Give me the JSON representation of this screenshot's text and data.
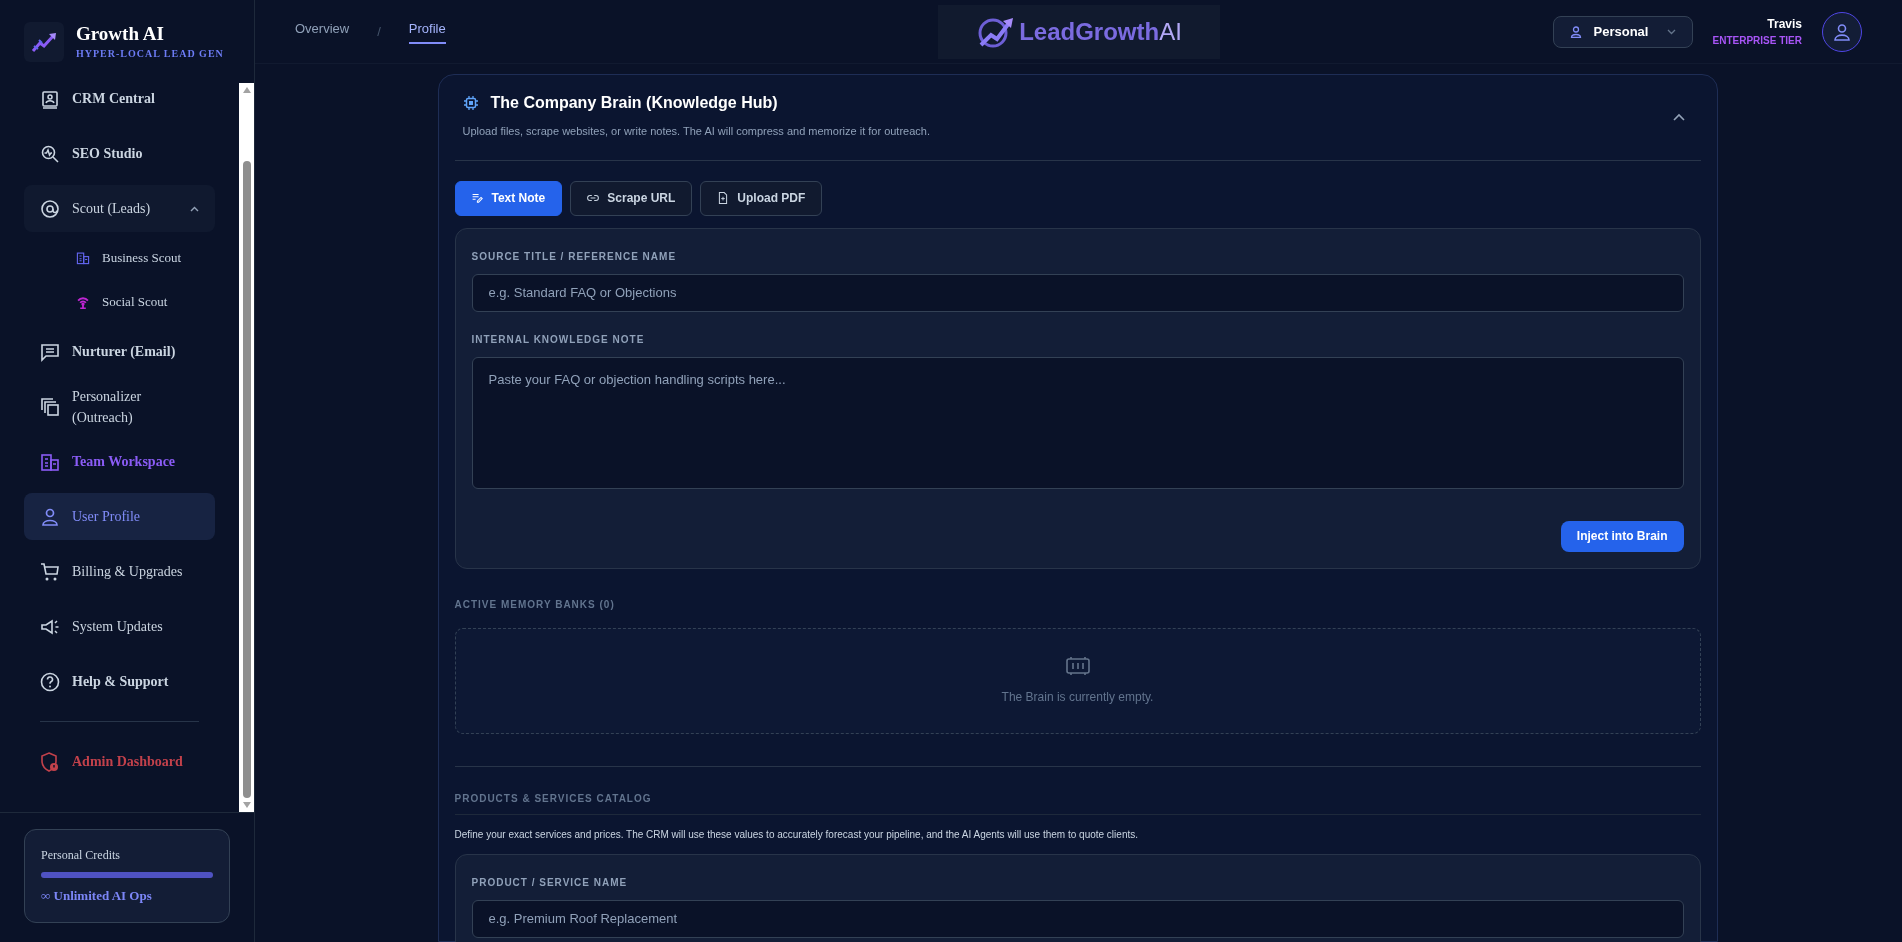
{
  "sidebar": {
    "brand": {
      "title": "Growth AI",
      "tagline": "HYPER-LOCAL LEAD GEN"
    },
    "items": [
      {
        "label": "CRM Central",
        "bold": true,
        "color": "#cbd5e1",
        "selected": false
      },
      {
        "label": "SEO Studio",
        "bold": true,
        "color": "#cbd5e1",
        "selected": false
      },
      {
        "label": "Scout (Leads)",
        "bold": false,
        "color": "#cbd5e1",
        "selected": false,
        "expanded": true,
        "children": [
          {
            "label": "Business Scout",
            "color": "#6366f1"
          },
          {
            "label": "Social Scout",
            "color": "#c026d3"
          }
        ]
      },
      {
        "label": "Nurturer (Email)",
        "bold": true,
        "color": "#cbd5e1",
        "selected": false
      },
      {
        "label": "Personalizer (Outreach)",
        "bold": false,
        "color": "#cbd5e1",
        "selected": false
      },
      {
        "label": "Team Workspace",
        "bold": true,
        "color": "#8b5cf6",
        "selected": false
      },
      {
        "label": "User Profile",
        "bold": false,
        "color": "#818cf8",
        "selected": true
      },
      {
        "label": "Billing & Upgrades",
        "bold": false,
        "color": "#cbd5e1",
        "selected": false
      },
      {
        "label": "System Updates",
        "bold": false,
        "color": "#cbd5e1",
        "selected": false
      },
      {
        "label": "Help & Support",
        "bold": true,
        "color": "#cbd5e1",
        "selected": false
      },
      {
        "label": "Admin Dashboard",
        "bold": true,
        "color": "#c2414b",
        "selected": false,
        "divider_before": true
      }
    ],
    "credits": {
      "label": "Personal Credits",
      "level": 1,
      "note": "∞ Unlimited AI Ops"
    }
  },
  "header": {
    "breadcrumbs": [
      {
        "label": "Overview",
        "selected": false
      },
      {
        "label": "/",
        "kind": "separator"
      },
      {
        "label": "Profile",
        "selected": true
      }
    ],
    "logo": {
      "main": "LeadGrowth",
      "suffix": "AI"
    },
    "workspace": "Personal",
    "user": {
      "name": "Travis",
      "tier": "ENTERPRISE TIER"
    }
  },
  "knowledge_hub": {
    "title": "The Company Brain (Knowledge Hub)",
    "subtitle": "Upload files, scrape websites, or write notes. The AI will compress and memorize it for outreach.",
    "expanded": true,
    "tabs": [
      {
        "label": "Text Note",
        "selected": true
      },
      {
        "label": "Scrape URL",
        "selected": false
      },
      {
        "label": "Upload PDF",
        "selected": false
      }
    ],
    "fields": [
      {
        "label": "SOURCE TITLE / REFERENCE NAME",
        "placeholder": "e.g. Standard FAQ or Objections",
        "kind": "input"
      },
      {
        "label": "INTERNAL KNOWLEDGE NOTE",
        "placeholder": "Paste your FAQ or objection handling scripts here...",
        "kind": "textarea"
      }
    ],
    "submit": "Inject into Brain",
    "memory": {
      "heading": "ACTIVE MEMORY BANKS (0)",
      "empty_text": "The Brain is currently empty."
    }
  },
  "catalog": {
    "heading": "PRODUCTS & SERVICES CATALOG",
    "description": "Define your exact services and prices. The CRM will use these values to accurately forecast your pipeline, and the AI Agents will use them to quote clients.",
    "fields": [
      {
        "label": "PRODUCT / SERVICE NAME",
        "placeholder": "e.g. Premium Roof Replacement"
      }
    ]
  }
}
